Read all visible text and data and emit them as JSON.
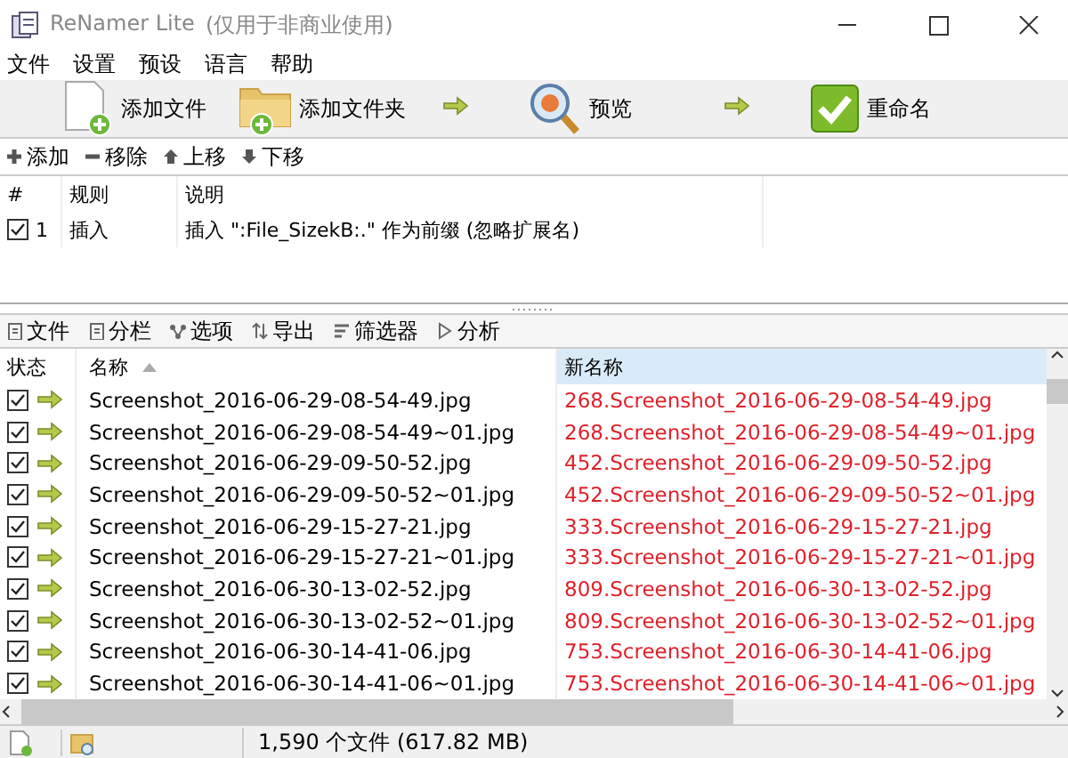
{
  "window": {
    "title": "ReNamer Lite",
    "subtitle": "(仅用于非商业使用)"
  },
  "menu": [
    "文件",
    "设置",
    "预设",
    "语言",
    "帮助"
  ],
  "toolbar": [
    {
      "kind": "add-file",
      "label": "添加文件"
    },
    {
      "kind": "add-folder",
      "label": "添加文件夹"
    },
    {
      "kind": "arrow"
    },
    {
      "kind": "preview",
      "label": "预览"
    },
    {
      "kind": "arrow"
    },
    {
      "kind": "rename",
      "label": "重命名"
    }
  ],
  "rule_toolbar": [
    {
      "kind": "plus",
      "label": "添加"
    },
    {
      "kind": "minus",
      "label": "移除"
    },
    {
      "kind": "up",
      "label": "上移"
    },
    {
      "kind": "down",
      "label": "下移"
    }
  ],
  "rules": {
    "columns": [
      "#",
      "规则",
      "说明"
    ],
    "rows": [
      {
        "checked": true,
        "index": "1",
        "rule": "插入",
        "description": "插入 \":File_SizekB:.\" 作为前缀 (忽略扩展名)"
      }
    ]
  },
  "file_tabs": [
    {
      "kind": "doc",
      "label": "文件"
    },
    {
      "kind": "doc",
      "label": "分栏"
    },
    {
      "kind": "nodes",
      "label": "选项"
    },
    {
      "kind": "export",
      "label": "导出"
    },
    {
      "kind": "filter",
      "label": "筛选器"
    },
    {
      "kind": "play",
      "label": "分析"
    }
  ],
  "files": {
    "columns": [
      {
        "label": "状态",
        "sorted": false,
        "highlighted": false
      },
      {
        "label": "名称",
        "sorted": true,
        "highlighted": false
      },
      {
        "label": "新名称",
        "sorted": false,
        "highlighted": true
      }
    ],
    "rows": [
      {
        "checked": true,
        "name": "Screenshot_2016-06-29-08-54-49.jpg",
        "new_name": "268.Screenshot_2016-06-29-08-54-49.jpg"
      },
      {
        "checked": true,
        "name": "Screenshot_2016-06-29-08-54-49~01.jpg",
        "new_name": "268.Screenshot_2016-06-29-08-54-49~01.jpg"
      },
      {
        "checked": true,
        "name": "Screenshot_2016-06-29-09-50-52.jpg",
        "new_name": "452.Screenshot_2016-06-29-09-50-52.jpg"
      },
      {
        "checked": true,
        "name": "Screenshot_2016-06-29-09-50-52~01.jpg",
        "new_name": "452.Screenshot_2016-06-29-09-50-52~01.jpg"
      },
      {
        "checked": true,
        "name": "Screenshot_2016-06-29-15-27-21.jpg",
        "new_name": "333.Screenshot_2016-06-29-15-27-21.jpg"
      },
      {
        "checked": true,
        "name": "Screenshot_2016-06-29-15-27-21~01.jpg",
        "new_name": "333.Screenshot_2016-06-29-15-27-21~01.jpg"
      },
      {
        "checked": true,
        "name": "Screenshot_2016-06-30-13-02-52.jpg",
        "new_name": "809.Screenshot_2016-06-30-13-02-52.jpg"
      },
      {
        "checked": true,
        "name": "Screenshot_2016-06-30-13-02-52~01.jpg",
        "new_name": "809.Screenshot_2016-06-30-13-02-52~01.jpg"
      },
      {
        "checked": true,
        "name": "Screenshot_2016-06-30-14-41-06.jpg",
        "new_name": "753.Screenshot_2016-06-30-14-41-06.jpg"
      },
      {
        "checked": true,
        "name": "Screenshot_2016-06-30-14-41-06~01.jpg",
        "new_name": "753.Screenshot_2016-06-30-14-41-06~01.jpg"
      }
    ]
  },
  "status_bar": {
    "summary": "1,590 个文件 (617.82 MB)"
  }
}
